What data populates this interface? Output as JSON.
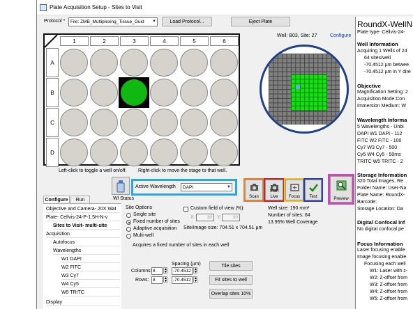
{
  "window": {
    "title": "Plate Acquisition Setup - Sites to Visit"
  },
  "toolbar": {
    "protocol_label": "Protocol *",
    "protocol_value": "File: ZMB_Multiplexing_Tissue_Guid",
    "load_protocol": "Load Protocol...",
    "eject_plate": "Eject Plate"
  },
  "well_info": {
    "text": "Well: B03,  Site: 27",
    "configure": "Configure"
  },
  "plate": {
    "columns": [
      "1",
      "2",
      "3",
      "4",
      "5",
      "6"
    ],
    "rows": [
      "A",
      "B",
      "C",
      "D"
    ],
    "selected_well": "B3",
    "hint_left": "Left-click to toggle a well on/off.",
    "hint_right": "Right-click to move the stage to that well."
  },
  "wavelength": {
    "status_label": "Wl Status",
    "active_label": "Active Wavelength",
    "active_value": "DAPI"
  },
  "buttons": {
    "scan": "Scan",
    "start_live": "Start Live",
    "focus": "Focus",
    "test": "Test",
    "preview": "Preview"
  },
  "highlight_colors": {
    "wavelength": "#29a8e0",
    "scan": "#f07d1e",
    "live": "#c0282d",
    "focus": "#f2c61f",
    "test": "#2c3fa8",
    "preview": "#c84bb5"
  },
  "tabs": [
    "Configure",
    "Run"
  ],
  "tree": [
    {
      "label": "Objective and Camera- 20X Wat",
      "indent": 0
    },
    {
      "label": "Plate- Cellvis-24-P-1.5H-N-v",
      "indent": 0
    },
    {
      "label": "Sites to Visit- multi-site",
      "indent": 1
    },
    {
      "label": "Acquisition",
      "indent": 0
    },
    {
      "label": "Autofocus",
      "indent": 1
    },
    {
      "label": "Wavelengths",
      "indent": 1
    },
    {
      "label": "W1 DAPI",
      "indent": 2
    },
    {
      "label": "W2 FITC",
      "indent": 2
    },
    {
      "label": "W3 Cy7",
      "indent": 2
    },
    {
      "label": "W4 Cy5",
      "indent": 2
    },
    {
      "label": "W5 TRITC",
      "indent": 2
    },
    {
      "label": "Display",
      "indent": 0
    }
  ],
  "site_options": {
    "group_label": "Site Options",
    "options": [
      "Single site",
      "Fixed number of sites",
      "Adaptive acquisition",
      "Multi-well"
    ],
    "selected": "Fixed number of sites",
    "custom_fov_label": "Custom field of view (%):",
    "fov_x_label": "X:",
    "fov_x": "30",
    "fov_y_label": "Y:",
    "fov_y": "30",
    "site_image_size": "Site/image size: 704.51 x 704.51  µm",
    "well_size": "Well size: 190 mm²",
    "num_sites": "Number of sites: 64",
    "coverage": "13.95% Well Coverage",
    "description": "Acquires a fixed number of sites in each well",
    "spacing_label": "Spacing (µm)",
    "columns_label": "Columns:",
    "columns_value": "8",
    "columns_spacing": "-70.4512",
    "rows_label": "Rows:",
    "rows_value": "8",
    "rows_spacing": "-70.4512",
    "tile_sites": "Tile sites",
    "fit_sites": "Fit sites to well",
    "overlap_sites": "Overlap sites 10%"
  },
  "info": {
    "title": "RoundX-WellN",
    "plate_type": "Plate type- Cellvis-24-",
    "well_info_h": "Well Information",
    "well_info_1": "Acquiring 1 Wells of 24",
    "well_info_2": "64 sites/well",
    "well_info_3": "-70.4512 µm betwee",
    "well_info_4": "-70.4512 µm in Y dire",
    "objective_h": "Objective",
    "objective_1": "Magnification Setting: 2",
    "objective_2": "Acquisition Mode:Con",
    "objective_3": "Immersion Medium: W",
    "wavelength_h": "Wavelength Informa",
    "wavelength_1": "5 Wavelengths - Unbi",
    "wavelength_2": "DAPI    W1 DAPI - 112",
    "wavelength_3": "FITC    W2 FITC - 100",
    "wavelength_4": "Cy7     W3 Cy7 - 500",
    "wavelength_5": "Cy5     W4 Cy5 - 50ms",
    "wavelength_6": "TRITC   W5 TRITC - 2",
    "storage_h": "Storage Information",
    "storage_1": "320 Total Images, Re",
    "storage_2": "Folder Name: User-Na",
    "storage_3": "Plate Name: RoundX-",
    "storage_4": "Barcode:",
    "storage_5": "Storage Location: Da",
    "confocal_h": "Digital Confocal Inf",
    "confocal_1": "No digital confocal pe",
    "focus_h": "Focus Information",
    "focus_1": "Laser focusing enable",
    "focus_2": "Image focusing enable",
    "focus_3": "Focusing each well",
    "focus_4": "W1: Laser with z-",
    "focus_5": "W2: Z-offset from",
    "focus_6": "W3: Z-offset from",
    "focus_7": "W4: Z-offset from",
    "focus_8": "W5: Z-offset from"
  }
}
